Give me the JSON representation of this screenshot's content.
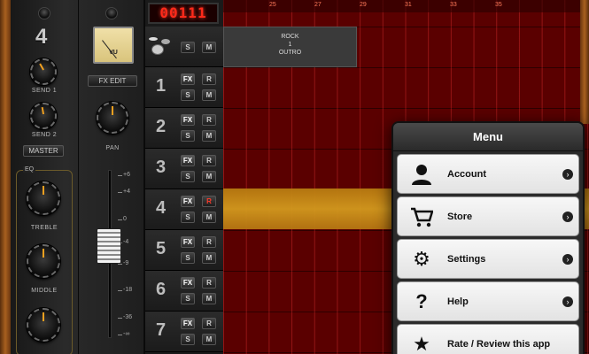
{
  "channel": {
    "number": "4",
    "send1_label": "SEND 1",
    "send2_label": "SEND 2",
    "master_label": "MASTER",
    "eq_label": "EQ",
    "treble_label": "TREBLE",
    "middle_label": "MIDDLE",
    "vu_label": "VU",
    "fx_edit_label": "FX EDIT",
    "pan_label": "PAN",
    "fader_scale": [
      "+6",
      "+4",
      "0",
      "-4",
      "-9",
      "-18",
      "-36",
      "-∞"
    ]
  },
  "transport": {
    "counter": "00111"
  },
  "drum_track": {
    "solo": "S",
    "mute": "M"
  },
  "tracks": [
    {
      "number": "1",
      "fx": "FX",
      "rec": "R",
      "solo": "S",
      "mute": "M"
    },
    {
      "number": "2",
      "fx": "FX",
      "rec": "R",
      "solo": "S",
      "mute": "M"
    },
    {
      "number": "3",
      "fx": "FX",
      "rec": "R",
      "solo": "S",
      "mute": "M"
    },
    {
      "number": "4",
      "fx": "FX",
      "rec": "R",
      "solo": "S",
      "mute": "M"
    },
    {
      "number": "5",
      "fx": "FX",
      "rec": "R",
      "solo": "S",
      "mute": "M"
    },
    {
      "number": "6",
      "fx": "FX",
      "rec": "R",
      "solo": "S",
      "mute": "M"
    },
    {
      "number": "7",
      "fx": "FX",
      "rec": "R",
      "solo": "S",
      "mute": "M"
    }
  ],
  "ruler": [
    "25",
    "27",
    "29",
    "31",
    "33",
    "35"
  ],
  "region": {
    "line1": "ROCK",
    "line2": "1",
    "line3": "OUTRO"
  },
  "menu": {
    "title": "Menu",
    "items": [
      {
        "label": "Account",
        "icon": "person-icon"
      },
      {
        "label": "Store",
        "icon": "cart-icon"
      },
      {
        "label": "Settings",
        "icon": "gear-icon"
      },
      {
        "label": "Help",
        "icon": "question-icon"
      },
      {
        "label": "Rate / Review this app",
        "icon": "star-icon"
      }
    ]
  },
  "colors": {
    "lcd": "#ff2a1a",
    "grid": "#5a0000",
    "selected_track": "#d39a1e"
  }
}
